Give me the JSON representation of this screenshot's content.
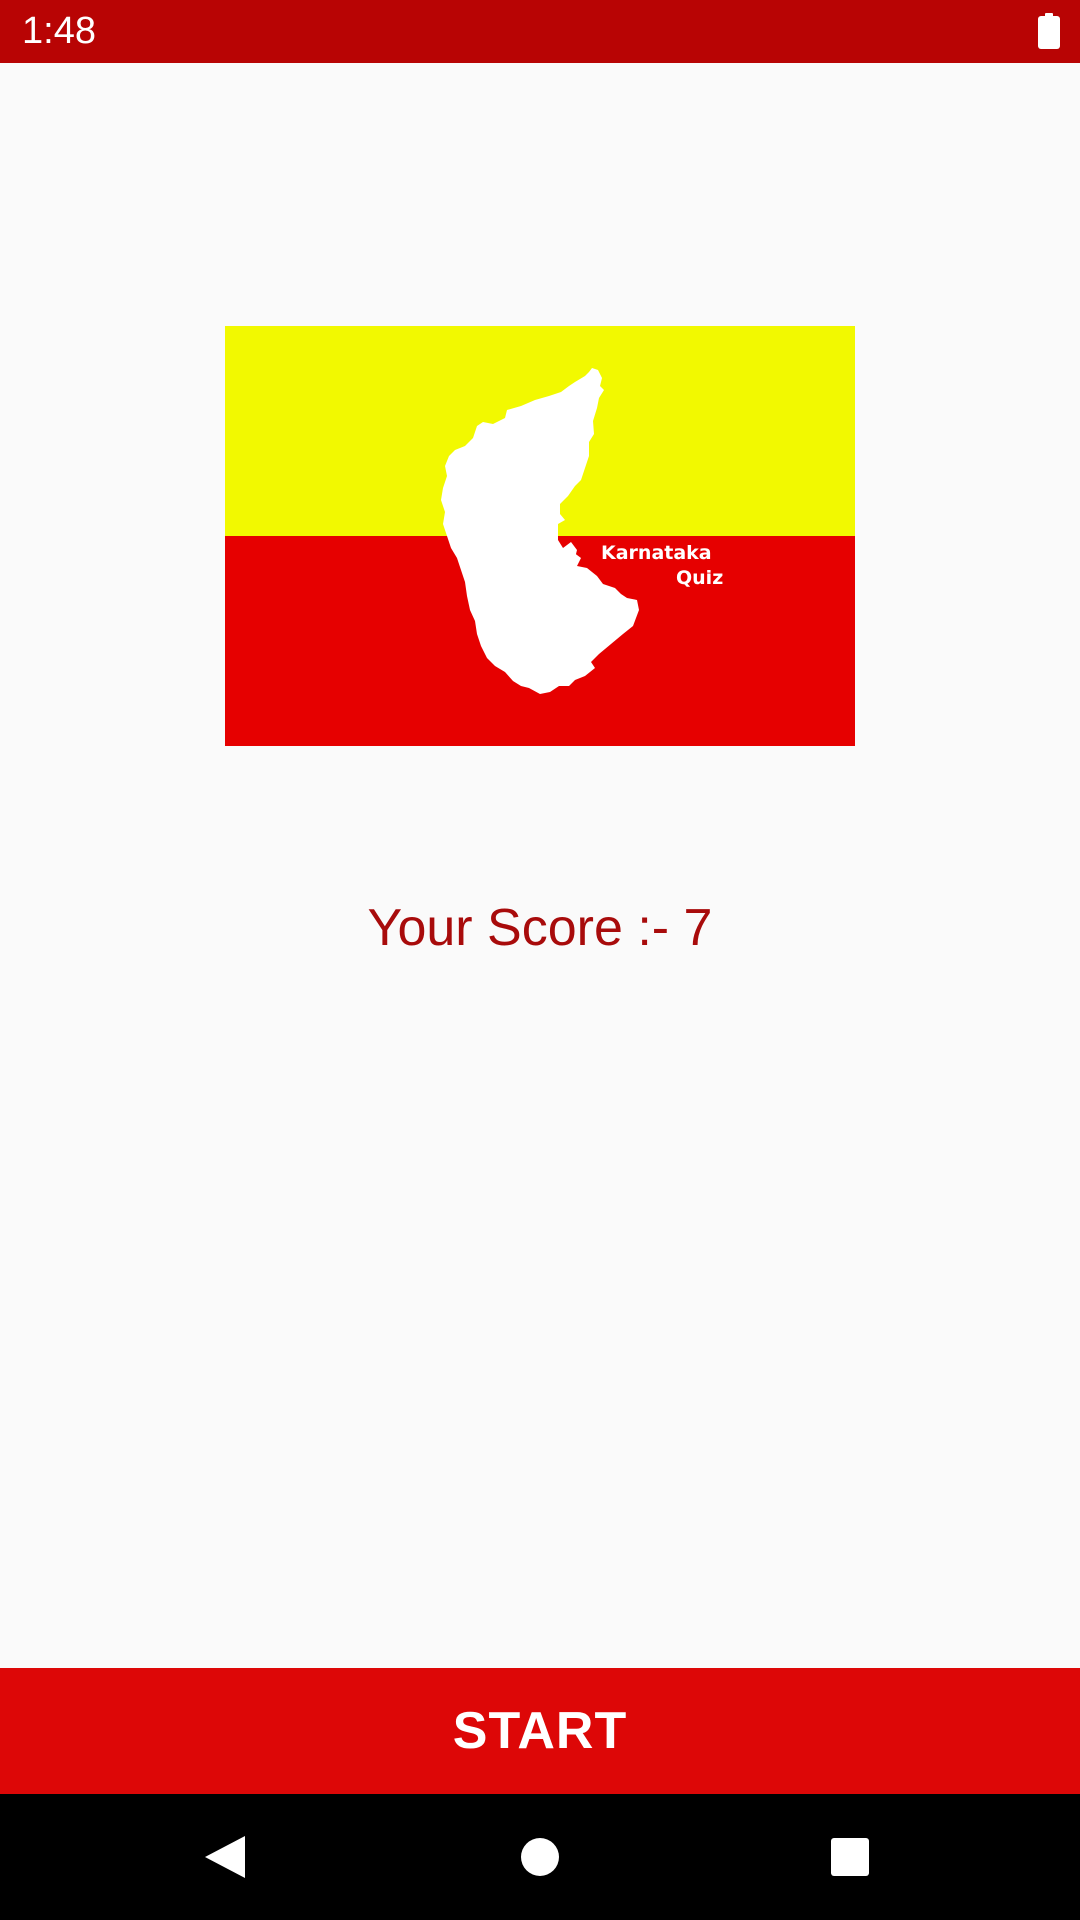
{
  "status_bar": {
    "time": "1:48",
    "battery_icon": "battery-full-icon",
    "background": "#b80404"
  },
  "logo": {
    "line1": "Karnataka",
    "line2": "Quiz",
    "colors": {
      "top": "#f2f900",
      "bottom": "#e60000",
      "map": "#ffffff"
    }
  },
  "score": {
    "text": "Your Score :- 7",
    "color": "#a80b0b"
  },
  "start_button": {
    "label": "START",
    "background": "#dd0707"
  },
  "nav_bar": {
    "back_icon": "back-triangle-icon",
    "home_icon": "home-circle-icon",
    "recents_icon": "recents-square-icon"
  }
}
